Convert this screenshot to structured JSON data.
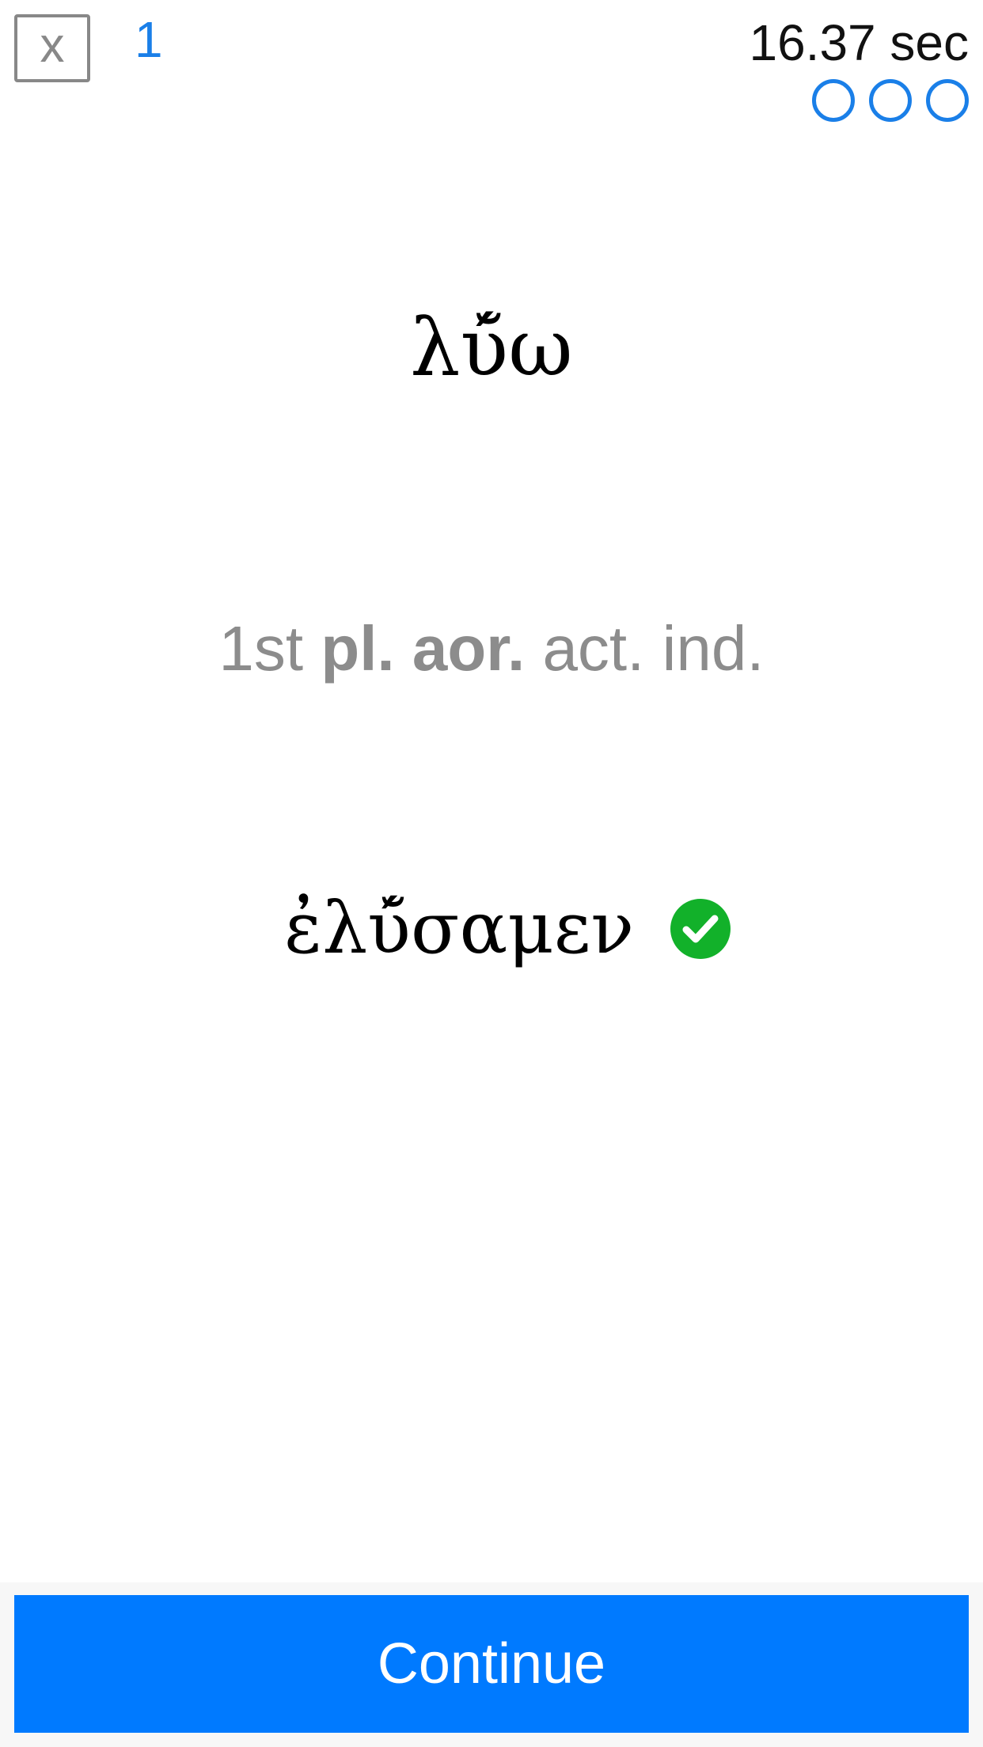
{
  "header": {
    "close_label": "x",
    "question_number": "1",
    "timer": "16.37 sec",
    "progress": {
      "total_dots": 3,
      "filled_dots": 0,
      "color": "#1a7fe8"
    }
  },
  "question": {
    "lemma": "λύ̆ω",
    "parsing": {
      "person": "1st",
      "number": "pl.",
      "tense": "aor.",
      "voice": "act.",
      "mood": "ind."
    }
  },
  "answer": {
    "text": "ἐλύ̆σαμεν",
    "status_icon": "check-circle-icon",
    "status_color": "#12b12a"
  },
  "footer": {
    "continue_label": "Continue",
    "button_color": "#007aff"
  }
}
